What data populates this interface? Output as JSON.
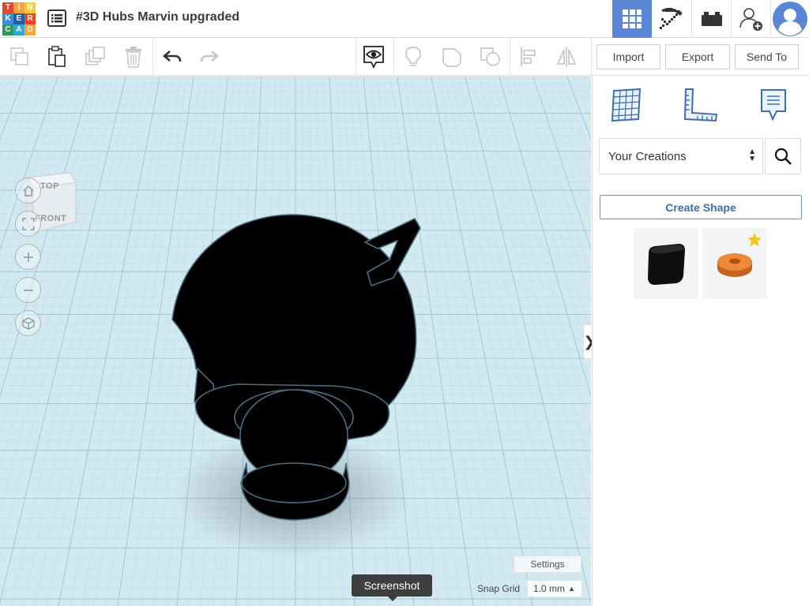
{
  "logo": {
    "letters": [
      "T",
      "I",
      "N",
      "K",
      "E",
      "R",
      "C",
      "A",
      "D"
    ],
    "colors": [
      "#e8452f",
      "#f9a43a",
      "#f2ce3c",
      "#3c8fd6",
      "#1f5fa8",
      "#e8452f",
      "#2a9a5c",
      "#33a9d8",
      "#f9a43a"
    ]
  },
  "header": {
    "project_title": "#3D Hubs Marvin upgraded",
    "modes": [
      "3D Design",
      "Codeblocks",
      "Bricks"
    ]
  },
  "toolbar": {
    "import_label": "Import",
    "export_label": "Export",
    "send_to_label": "Send To"
  },
  "viewcube": {
    "top_label": "TOP",
    "front_label": "FRONT"
  },
  "workplane": {
    "settings_label": "Settings",
    "snap_grid_label": "Snap Grid",
    "snap_grid_value": "1.0 mm",
    "tooltip": "Screenshot",
    "collapse_glyph": "❯"
  },
  "panel": {
    "library_value": "Your Creations",
    "create_shape_label": "Create Shape",
    "shapes": [
      {
        "name": "black-cube",
        "color": "#111111",
        "starred": false
      },
      {
        "name": "orange-ring",
        "color": "#e07a2c",
        "starred": true
      }
    ]
  },
  "colors": {
    "accent": "#5b86d6",
    "grid_bg": "#d3e9f1",
    "model": "#000000",
    "model_edge": "#4e6d80"
  }
}
